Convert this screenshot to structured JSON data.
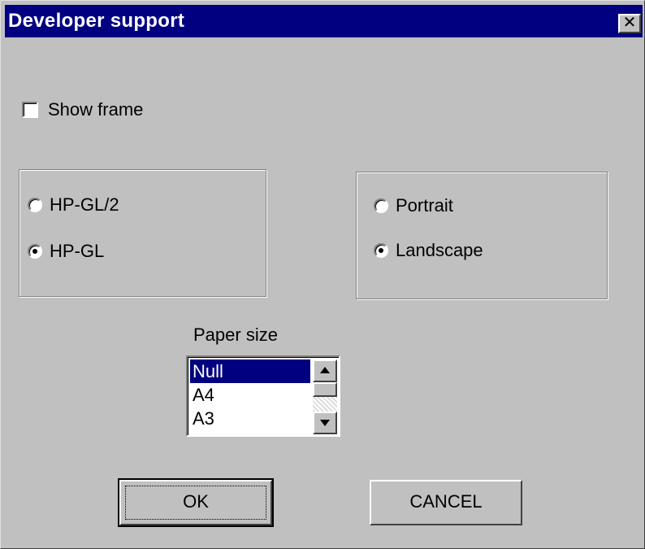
{
  "window": {
    "title": "Developer support",
    "close_glyph": "✕",
    "close_icon": "close-icon",
    "colors": {
      "titlebar": "#000080",
      "face": "#c0c0c0",
      "selection": "#000080"
    }
  },
  "show_frame": {
    "label": "Show frame",
    "checked": false
  },
  "format_group": {
    "options": [
      {
        "label": "HP-GL/2",
        "selected": false
      },
      {
        "label": "HP-GL",
        "selected": true
      }
    ]
  },
  "orientation_group": {
    "options": [
      {
        "label": "Portrait",
        "selected": false
      },
      {
        "label": "Landscape",
        "selected": true
      }
    ]
  },
  "paper_size": {
    "label": "Paper size",
    "items": [
      "Null",
      "A4",
      "A3"
    ],
    "selected": "Null",
    "scroll_up_icon": "scroll-up-arrow-icon",
    "scroll_down_icon": "scroll-down-arrow-icon"
  },
  "buttons": {
    "ok_label": "OK",
    "cancel_label": "CANCEL"
  }
}
